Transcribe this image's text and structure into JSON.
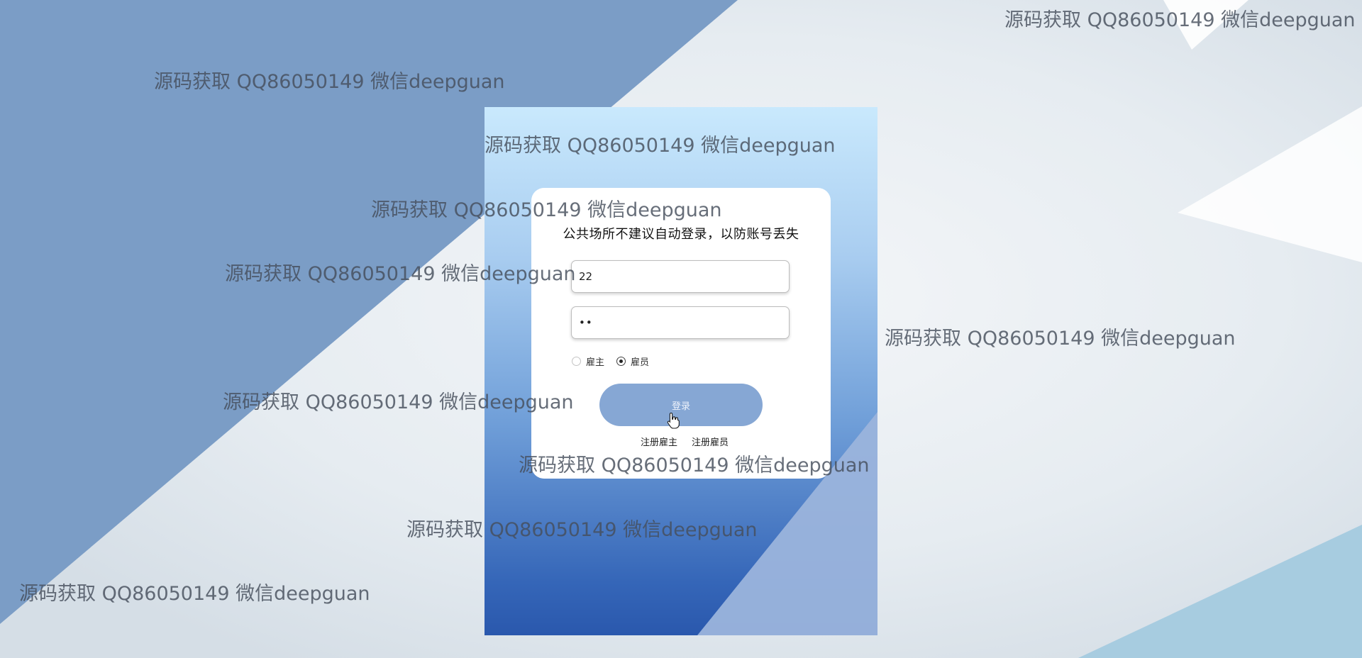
{
  "colors": {
    "left_blue": "#7b9dc6",
    "panel_top": "#c9e9fd",
    "panel_bottom": "#2a58ad",
    "button": "#86a7d4",
    "light_blue_corner": "#a7cce0"
  },
  "login": {
    "notice": "公共场所不建议自动登录，以防账号丢失",
    "username_value": "22",
    "password_value": "••",
    "roles": [
      {
        "label": "雇主",
        "checked": false
      },
      {
        "label": "雇员",
        "checked": true
      }
    ],
    "submit_label": "登录",
    "register_employer": "注册雇主",
    "register_employee": "注册雇员"
  },
  "watermark": {
    "text": "源码获取 QQ86050149 微信deepguan"
  }
}
